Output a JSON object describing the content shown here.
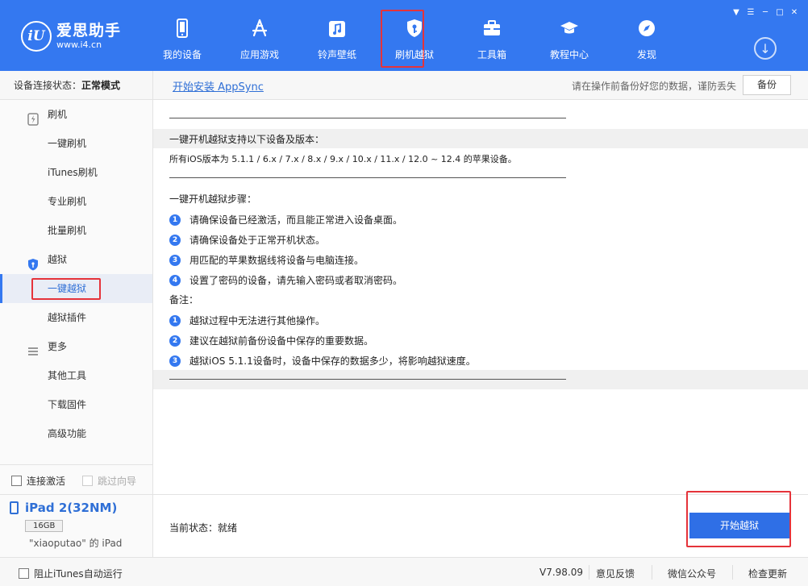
{
  "app": {
    "logo_mark": "iU",
    "name": "爱思助手",
    "url": "www.i4.cn"
  },
  "nav": [
    {
      "label": "我的设备",
      "icon": "phone-icon",
      "active": false
    },
    {
      "label": "应用游戏",
      "icon": "app-store-icon",
      "active": false
    },
    {
      "label": "铃声壁纸",
      "icon": "music-note-icon",
      "active": false
    },
    {
      "label": "刷机越狱",
      "icon": "shield-key-icon",
      "active": true
    },
    {
      "label": "工具箱",
      "icon": "toolbox-icon",
      "active": false
    },
    {
      "label": "教程中心",
      "icon": "graduation-cap-icon",
      "active": false
    },
    {
      "label": "发现",
      "icon": "compass-icon",
      "active": false
    }
  ],
  "window_controls": [
    "shirt-icon",
    "settings-icon",
    "minimize-icon",
    "maximize-icon",
    "close-icon"
  ],
  "status": {
    "label": "设备连接状态：",
    "value": "正常模式"
  },
  "toolbar": {
    "appsync_link": "开始安装 AppSync",
    "backup_hint": "请在操作前备份好您的数据，谨防丢失",
    "backup_label": "备份"
  },
  "sidebar": {
    "flash_group": "刷机",
    "flash_items": [
      "一键刷机",
      "iTunes刷机",
      "专业刷机",
      "批量刷机"
    ],
    "jailbreak_group": "越狱",
    "jailbreak_items": [
      "一键越狱",
      "越狱插件"
    ],
    "jailbreak_active_index": 0,
    "more_group": "更多",
    "more_items": [
      "其他工具",
      "下载固件",
      "高级功能"
    ],
    "activate_label": "连接激活",
    "skip_guide_label": "跳过向导"
  },
  "device": {
    "name": "iPad 2(32NM)",
    "capacity": "16GB",
    "owner": "\"xiaoputao\" 的 iPad"
  },
  "content": {
    "support_title": "一键开机越狱支持以下设备及版本：",
    "support_text": "所有iOS版本为 5.1.1 / 6.x / 7.x / 8.x / 9.x / 10.x / 11.x / 12.0 ~ 12.4 的苹果设备。",
    "steps_title": "一键开机越狱步骤：",
    "steps": [
      "请确保设备已经激活，而且能正常进入设备桌面。",
      "请确保设备处于正常开机状态。",
      "用匹配的苹果数据线将设备与电脑连接。",
      "设置了密码的设备，请先输入密码或者取消密码。"
    ],
    "notes_title": "备注：",
    "notes": [
      "越狱过程中无法进行其他操作。",
      "建议在越狱前备份设备中保存的重要数据。",
      "越狱iOS 5.1.1设备时，设备中保存的数据多少，将影响越狱速度。"
    ]
  },
  "action": {
    "current_status_label": "当前状态：",
    "current_status_value": "就绪",
    "start_button": "开始越狱"
  },
  "footer": {
    "block_itunes_label": "阻止iTunes自动运行",
    "version": "V7.98.09",
    "feedback": "意见反馈",
    "wechat": "微信公众号",
    "check_update": "检查更新"
  },
  "colors": {
    "header_bg": "#3478f0",
    "accent": "#2f6fd6",
    "highlight_red": "#e5333a"
  }
}
